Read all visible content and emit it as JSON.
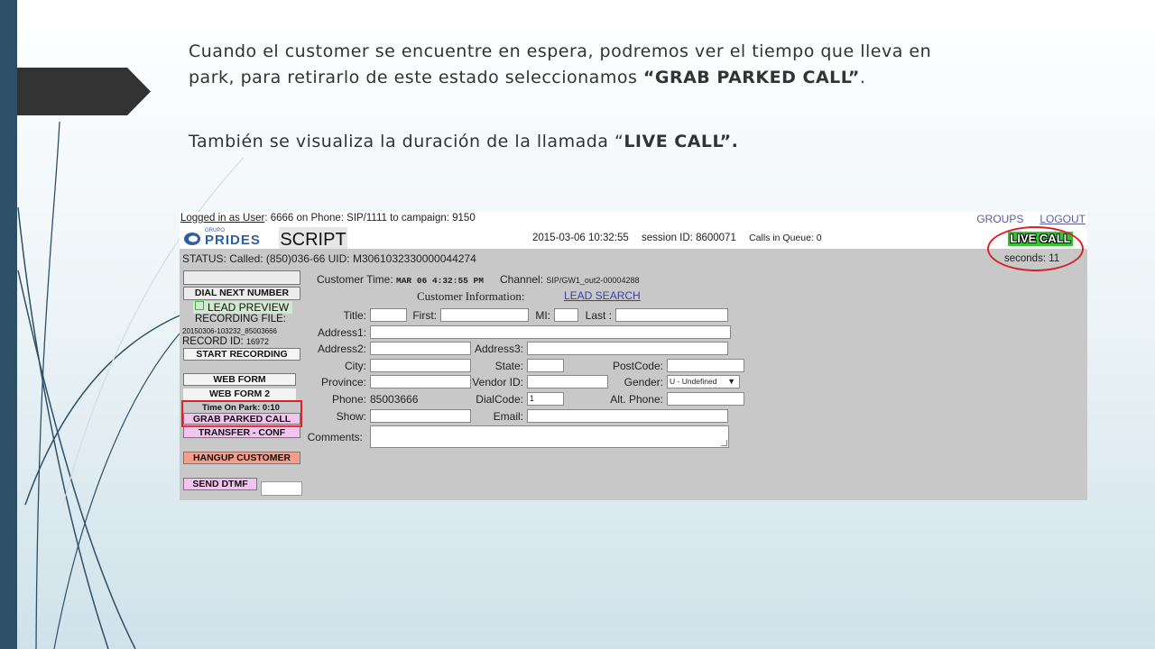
{
  "slide": {
    "para1_pre": "Cuando el customer se encuentre en espera, podremos ver el tiempo que lleva en park, para retirarlo de este estado seleccionamos ",
    "para1_bold": "“GRAB PARKED CALL”",
    "para1_post": ".",
    "para2_pre": "También se visualiza la duración de la llamada “",
    "para2_bold": "LIVE CALL”.",
    "colors": {
      "left_bar": "#2e5066",
      "arrow_tab": "#333333",
      "highlight": "#d9232b"
    }
  },
  "app": {
    "topline": {
      "logged_in_label": "Logged in as User",
      "logged_in_rest": ": 6666 on Phone: SIP/1111  to campaign: 9150",
      "groups": "GROUPS",
      "logout": "LOGOUT"
    },
    "logo": {
      "small": "GRUPO",
      "big": "PRIDES"
    },
    "script_tab": "SCRIPT",
    "datetime": "2015-03-06 10:32:55",
    "session": "session ID: 8600071",
    "queue": "Calls in Queue: 0",
    "live_call": "LIVE CALL",
    "seconds": "seconds: 11",
    "status": "STATUS: Called: (850)036-66 UID: M3061032330000044274",
    "sidebar": {
      "dial_next": "DIAL NEXT NUMBER",
      "lead_preview": "LEAD PREVIEW",
      "recording_file_label": "RECORDING FILE:",
      "recording_file": "20150306-103232_85003666",
      "record_id_label": "RECORD ID:",
      "record_id": "16972",
      "start_recording": "START RECORDING",
      "web_form": "WEB FORM",
      "web_form_2": "WEB FORM 2",
      "time_on_park": "Time On Park: 0:10",
      "grab_parked": "GRAB PARKED CALL",
      "transfer": "TRANSFER - CONF",
      "hangup": "HANGUP CUSTOMER",
      "send_dtmf": "SEND DTMF"
    },
    "form": {
      "customer_time_label": "Customer Time:",
      "customer_time": "MAR 06 4:32:55 PM",
      "channel_label": "Channel:",
      "channel": "SIP/GW1_out2-00004288",
      "customer_info": "Customer Information:",
      "lead_search": "LEAD SEARCH",
      "title": "Title:",
      "first": "First:",
      "mi": "MI:",
      "last": "Last :",
      "address1": "Address1:",
      "address2": "Address2:",
      "address3": "Address3:",
      "city": "City:",
      "state": "State:",
      "postcode": "PostCode:",
      "province": "Province:",
      "vendor_id": "Vendor ID:",
      "gender": "Gender:",
      "gender_value": "U - Undefined",
      "phone_label": "Phone:",
      "phone": "85003666",
      "dialcode": "DialCode:",
      "dialcode_value": "1",
      "alt_phone": "Alt. Phone:",
      "show": "Show:",
      "email": "Email:",
      "comments": "Comments:"
    }
  }
}
